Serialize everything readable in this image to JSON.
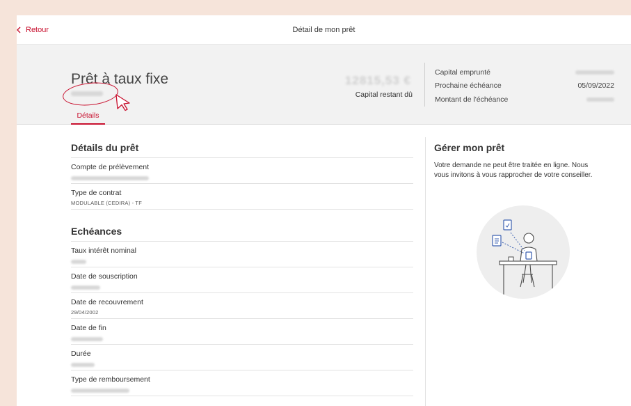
{
  "topbar": {
    "back_label": "Retour",
    "title": "Détail de mon prêt"
  },
  "loan": {
    "title": "Prêt à taux fixe",
    "amount_display": "12815,53 €",
    "remaining_label": "Capital restant dû",
    "tab_label": "Détails"
  },
  "summary": {
    "rows": [
      {
        "label": "Capital emprunté",
        "value": ""
      },
      {
        "label": "Prochaine échéance",
        "value": "05/09/2022"
      },
      {
        "label": "Montant de l'échéance",
        "value": ""
      }
    ]
  },
  "details": {
    "title": "Détails du prêt",
    "fields": [
      {
        "label": "Compte de prélèvement",
        "value": ""
      },
      {
        "label": "Type de contrat",
        "value": "MODULABLE (CEDIRA) - TF"
      }
    ]
  },
  "schedule": {
    "title": "Echéances",
    "fields": [
      {
        "label": "Taux intérêt nominal",
        "value": ""
      },
      {
        "label": "Date de souscription",
        "value": ""
      },
      {
        "label": "Date de recouvrement",
        "value": "29/04/2002"
      },
      {
        "label": "Date de fin",
        "value": ""
      },
      {
        "label": "Durée",
        "value": ""
      },
      {
        "label": "Type de remboursement",
        "value": ""
      }
    ]
  },
  "manage": {
    "title": "Gérer mon prêt",
    "text": "Votre demande ne peut être traitée en ligne. Nous vous invitons à vous rapprocher de votre conseiller."
  },
  "colors": {
    "accent": "#c8102e",
    "hero_bg": "#f2f2f2",
    "page_bg": "#f6e4da"
  },
  "icons": [
    "chevron-left-icon",
    "pointer-cursor-icon",
    "advisor-illustration"
  ]
}
